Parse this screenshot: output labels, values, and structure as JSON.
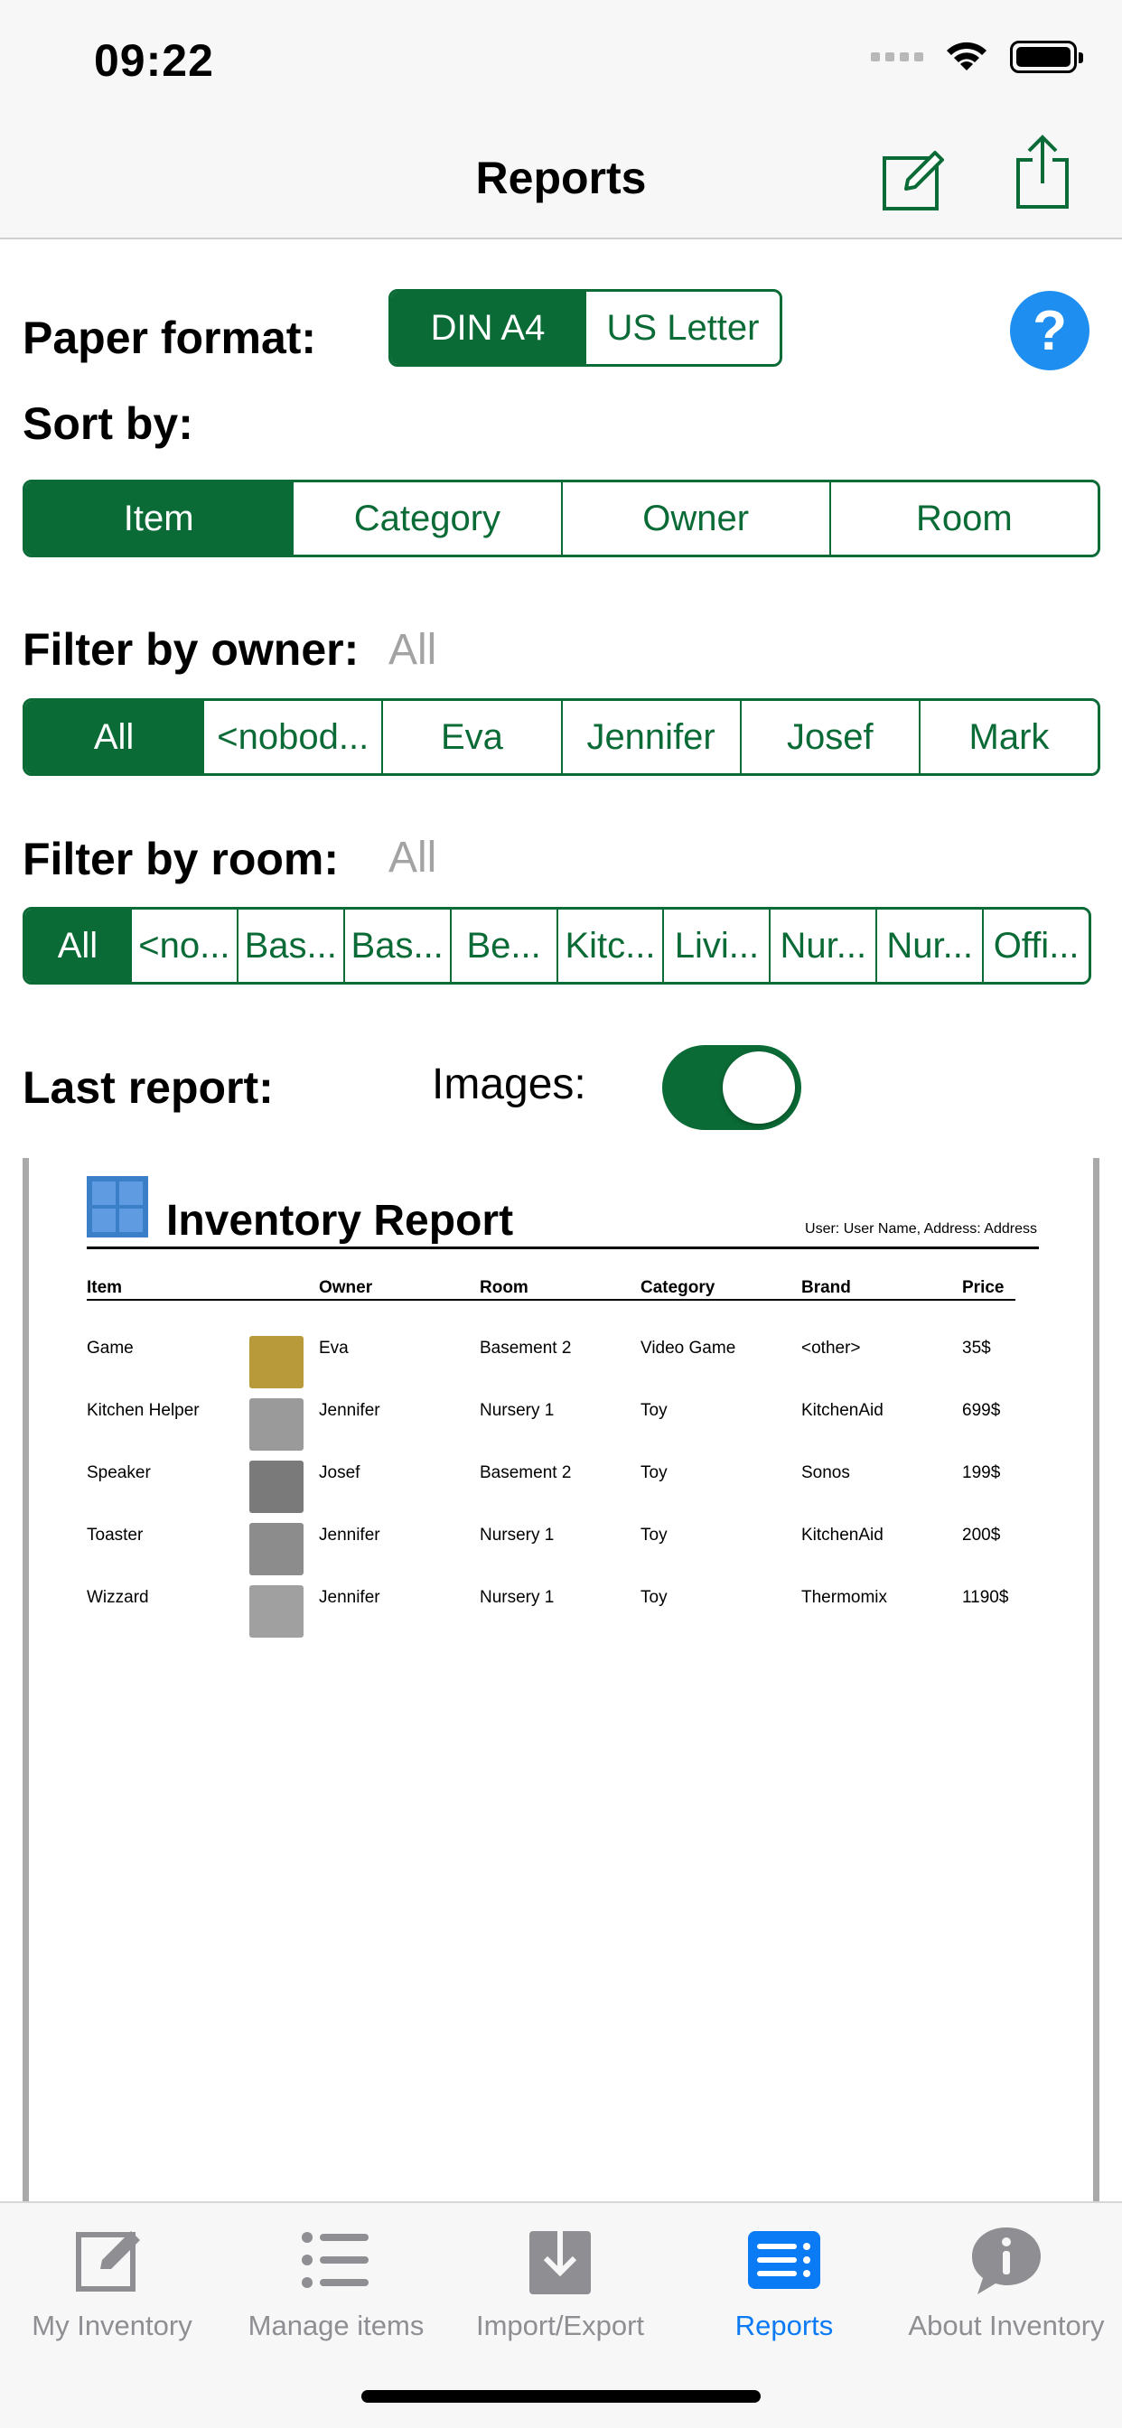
{
  "status": {
    "time": "09:22"
  },
  "nav": {
    "title": "Reports"
  },
  "paper": {
    "label": "Paper format:",
    "options": [
      "DIN A4",
      "US Letter"
    ],
    "selected": "DIN A4"
  },
  "sort": {
    "label": "Sort by:",
    "options": [
      "Item",
      "Category",
      "Owner",
      "Room"
    ],
    "selected": "Item"
  },
  "owner_filter": {
    "label": "Filter by owner:",
    "value": "All",
    "options": [
      "All",
      "<nobod...",
      "Eva",
      "Jennifer",
      "Josef",
      "Mark"
    ],
    "selected": "All"
  },
  "room_filter": {
    "label": "Filter by room:",
    "value": "All",
    "options": [
      "All",
      "<no...",
      "Bas...",
      "Bas...",
      "Be...",
      "Kitc...",
      "Livi...",
      "Nur...",
      "Nur...",
      "Offi..."
    ],
    "selected": "All"
  },
  "last_report": {
    "label": "Last report:",
    "images_label": "Images:",
    "images_on": true
  },
  "report": {
    "title": "Inventory Report",
    "user_line": "User: User Name, Address: Address",
    "headers": [
      "Item",
      "Owner",
      "Room",
      "Category",
      "Brand",
      "Price"
    ],
    "rows": [
      {
        "item": "Game",
        "owner": "Eva",
        "room": "Basement 2",
        "category": "Video Game",
        "brand": "<other>",
        "price": "35$",
        "thumb": "#b89a3a"
      },
      {
        "item": "Kitchen Helper",
        "owner": "Jennifer",
        "room": "Nursery 1",
        "category": "Toy",
        "brand": "KitchenAid",
        "price": "699$",
        "thumb": "#9a9a9a"
      },
      {
        "item": "Speaker",
        "owner": "Josef",
        "room": "Basement 2",
        "category": "Toy",
        "brand": "Sonos",
        "price": "199$",
        "thumb": "#7a7a7a"
      },
      {
        "item": "Toaster",
        "owner": "Jennifer",
        "room": "Nursery 1",
        "category": "Toy",
        "brand": "KitchenAid",
        "price": "200$",
        "thumb": "#8c8c8c"
      },
      {
        "item": "Wizzard",
        "owner": "Jennifer",
        "room": "Nursery 1",
        "category": "Toy",
        "brand": "Thermomix",
        "price": "1190$",
        "thumb": "#a0a0a0"
      }
    ]
  },
  "tabs": [
    {
      "label": "My Inventory",
      "icon": "edit-square-icon"
    },
    {
      "label": "Manage items",
      "icon": "list-icon"
    },
    {
      "label": "Import/Export",
      "icon": "download-tray-icon"
    },
    {
      "label": "Reports",
      "icon": "report-list-icon"
    },
    {
      "label": "About Inventory",
      "icon": "info-bubble-icon"
    }
  ],
  "colors": {
    "accent": "#0b6b36",
    "tab_active": "#0b7af5",
    "help": "#1e8ff0"
  }
}
